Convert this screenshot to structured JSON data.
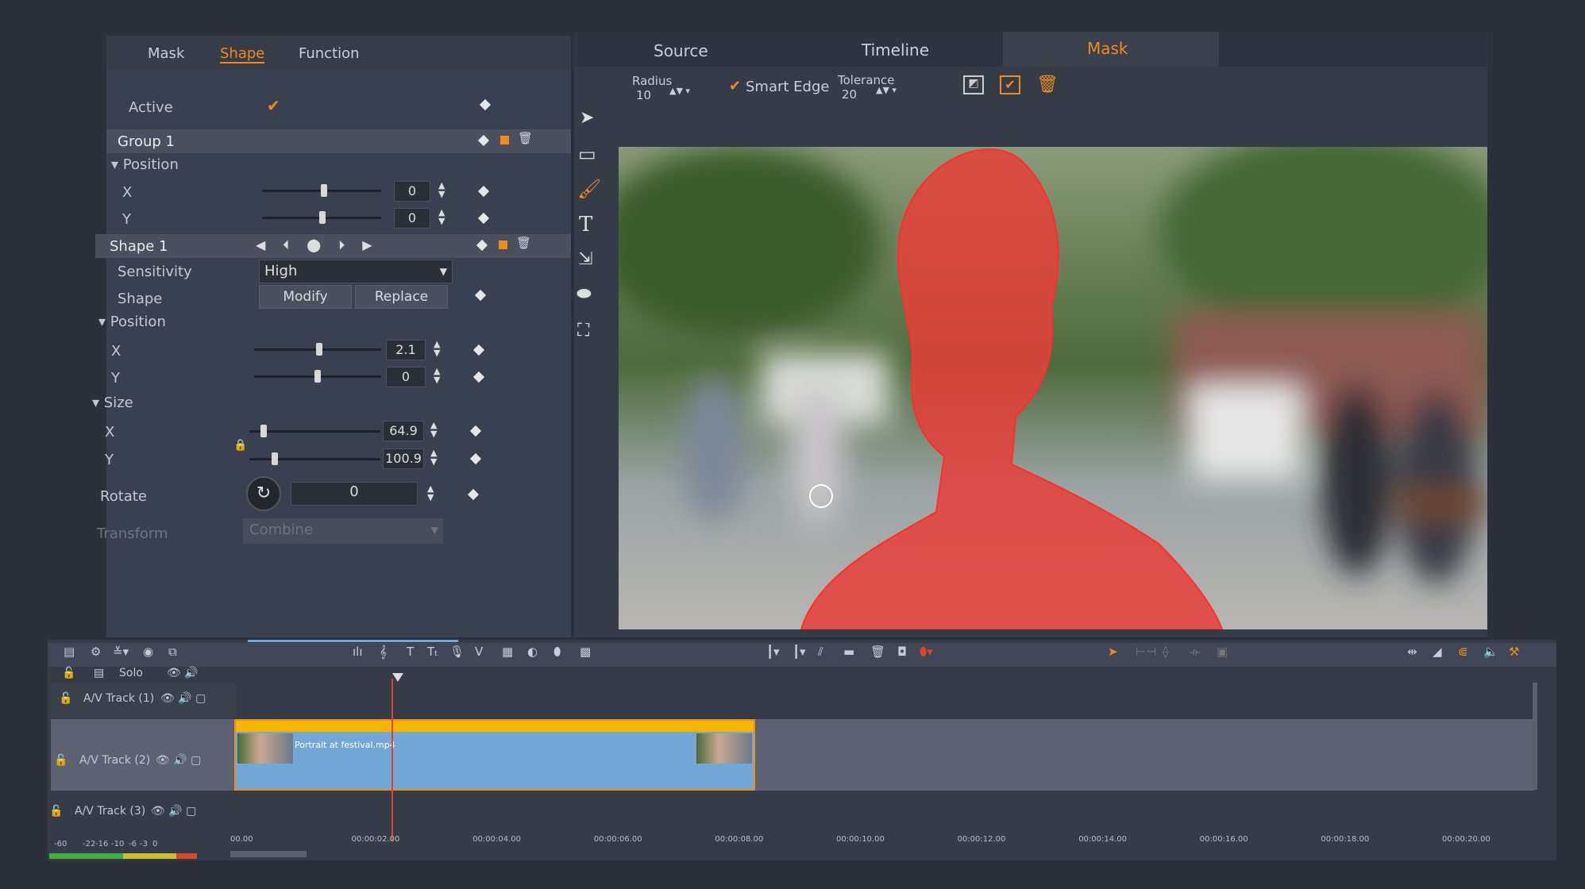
{
  "left_panel": {
    "tabs": [
      {
        "label": "Mask"
      },
      {
        "label": "Shape",
        "active": true
      },
      {
        "label": "Function"
      }
    ],
    "active_label": "Active",
    "active_checked": true,
    "group": {
      "label": "Group 1",
      "position_label": "Position",
      "x_label": "X",
      "x_value": "0",
      "y_label": "Y",
      "y_value": "0"
    },
    "shape": {
      "label": "Shape 1",
      "sensitivity_label": "Sensitivity",
      "sensitivity_value": "High",
      "shape_label": "Shape",
      "modify": "Modify",
      "replace": "Replace",
      "position_label": "Position",
      "x_label": "X",
      "x_value": "2.1",
      "y_label": "Y",
      "y_value": "0",
      "size_label": "Size",
      "sx_label": "X",
      "sx_value": "64.9",
      "sy_label": "Y",
      "sy_value": "100.9",
      "rotate_label": "Rotate",
      "rotate_value": "0",
      "transform_label": "Transform",
      "transform_value": "Combine"
    }
  },
  "right_panel": {
    "tabs": [
      {
        "label": "Source"
      },
      {
        "label": "Timeline"
      },
      {
        "label": "Mask",
        "active": true
      }
    ],
    "radius_label": "Radius",
    "radius_value": "10",
    "smart_edge_label": "Smart Edge",
    "smart_edge_checked": true,
    "tolerance_label": "Tolerance",
    "tolerance_value": "20"
  },
  "timeline": {
    "solo": "Solo",
    "tracks": [
      {
        "name": "A/V Track (1)"
      },
      {
        "name": "A/V Track (2)"
      },
      {
        "name": "A/V Track (3)"
      }
    ],
    "clip": {
      "name": "Portrait at festival.mp4"
    },
    "meter_labels": [
      "-60",
      "-22",
      "-16",
      "-10",
      "-6",
      "-3",
      "0"
    ],
    "ruler": [
      "00.00",
      "00:00:02.00",
      "00:00:04.00",
      "00:00:06.00",
      "00:00:08.00",
      "00:00:10.00",
      "00:00:12.00",
      "00:00:14.00",
      "00:00:16.00",
      "00:00:18.00",
      "00:00:20.00"
    ]
  },
  "colors": {
    "accent": "#f08a1c",
    "mask": "#e8403a",
    "clip": "#72a7d8",
    "clip_bar": "#f7b500"
  }
}
